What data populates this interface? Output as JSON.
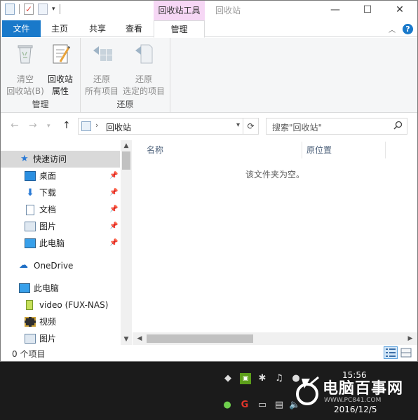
{
  "titlebar": {
    "context_tab": "回收站工具",
    "title": "回收站",
    "minimize": "—",
    "maximize": "☐",
    "close": "✕"
  },
  "ribbon_tabs": {
    "file": "文件",
    "home": "主页",
    "share": "共享",
    "view": "查看",
    "manage": "管理",
    "help": "?"
  },
  "ribbon": {
    "groups": [
      {
        "label": "管理",
        "buttons": [
          {
            "line1": "清空",
            "line2": "回收站(B)",
            "icon": "empty-recycle-bin-icon",
            "enabled": false
          },
          {
            "line1": "回收站",
            "line2": "属性",
            "icon": "recycle-bin-properties-icon",
            "enabled": true
          }
        ]
      },
      {
        "label": "还原",
        "buttons": [
          {
            "line1": "还原",
            "line2": "所有项目",
            "icon": "restore-all-icon",
            "enabled": false
          },
          {
            "line1": "还原",
            "line2": "选定的项目",
            "icon": "restore-selected-icon",
            "enabled": false
          }
        ]
      }
    ]
  },
  "address": {
    "path": "回收站",
    "search_placeholder": "搜索\"回收站\""
  },
  "navpane": {
    "items": [
      {
        "label": "快速访问",
        "icon": "star-icon",
        "selected": true,
        "pinned": false
      },
      {
        "label": "桌面",
        "icon": "desktop-icon",
        "selected": false,
        "pinned": true
      },
      {
        "label": "下载",
        "icon": "download-icon",
        "selected": false,
        "pinned": true
      },
      {
        "label": "文档",
        "icon": "document-icon",
        "selected": false,
        "pinned": true
      },
      {
        "label": "图片",
        "icon": "pictures-icon",
        "selected": false,
        "pinned": true
      },
      {
        "label": "此电脑",
        "icon": "computer-icon",
        "selected": false,
        "pinned": true
      },
      {
        "label": "OneDrive",
        "icon": "cloud-icon",
        "selected": false,
        "pinned": false
      },
      {
        "label": "此电脑",
        "icon": "computer-icon",
        "selected": false,
        "pinned": false
      },
      {
        "label": "video (FUX-NAS)",
        "icon": "network-drive-icon",
        "selected": false,
        "pinned": false
      },
      {
        "label": "视频",
        "icon": "videos-icon",
        "selected": false,
        "pinned": false
      },
      {
        "label": "图片",
        "icon": "pictures-icon",
        "selected": false,
        "pinned": false
      }
    ]
  },
  "content": {
    "col_name": "名称",
    "col_location": "原位置",
    "empty_message": "该文件夹为空。"
  },
  "statusbar": {
    "item_count": "0 个项目"
  },
  "taskbar": {
    "time": "15:56",
    "date": "2016/12/5",
    "watermark_text": "电脑百事网",
    "watermark_url": "WWW.PC841.COM"
  }
}
